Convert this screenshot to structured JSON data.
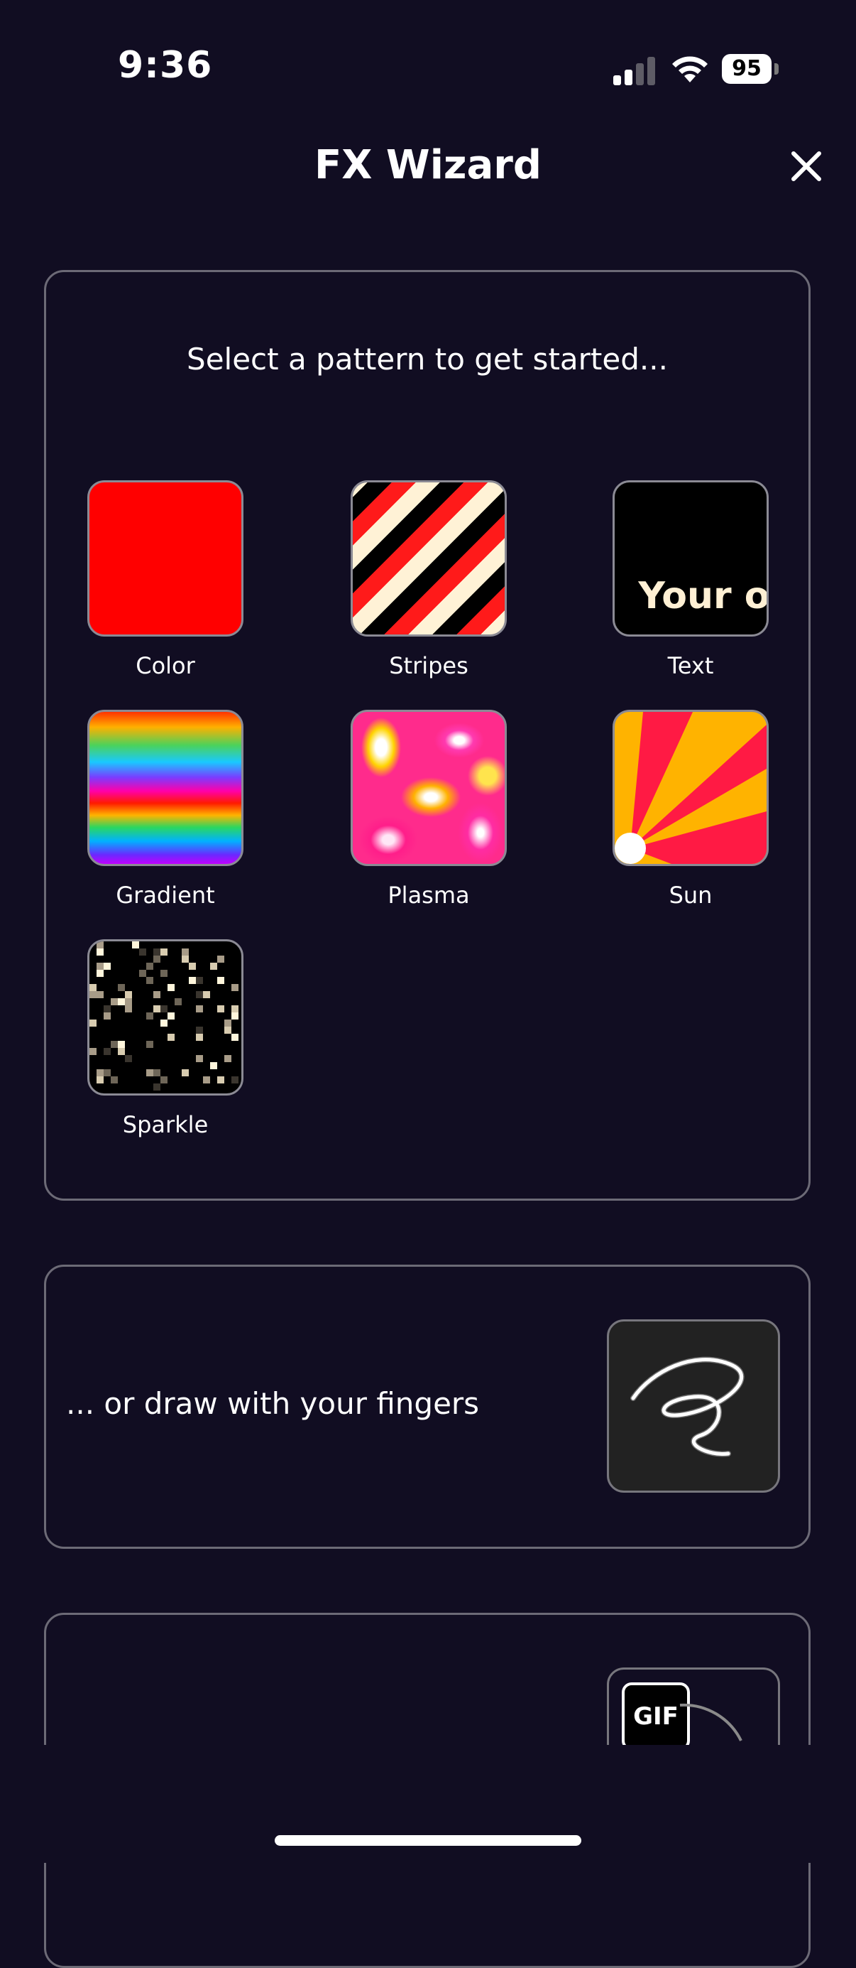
{
  "status_bar": {
    "time": "9:36",
    "battery_level": "95"
  },
  "header": {
    "title": "FX Wizard",
    "close_icon": "close-icon"
  },
  "patterns_card": {
    "prompt": "Select a pattern to get started...",
    "patterns": [
      {
        "label": "Color"
      },
      {
        "label": "Stripes"
      },
      {
        "label": "Text",
        "preview_text": "Your ow"
      },
      {
        "label": "Gradient"
      },
      {
        "label": "Plasma"
      },
      {
        "label": "Sun"
      },
      {
        "label": "Sparkle"
      }
    ]
  },
  "draw_card": {
    "text": "... or draw with your fingers",
    "icon": "squiggle-icon"
  },
  "gif_card": {
    "badge": "GIF"
  },
  "colors": {
    "background": "#110d22",
    "card_border": "#6c6a76",
    "sun_red": "#ff1a44",
    "sun_orange": "#ffb300"
  }
}
